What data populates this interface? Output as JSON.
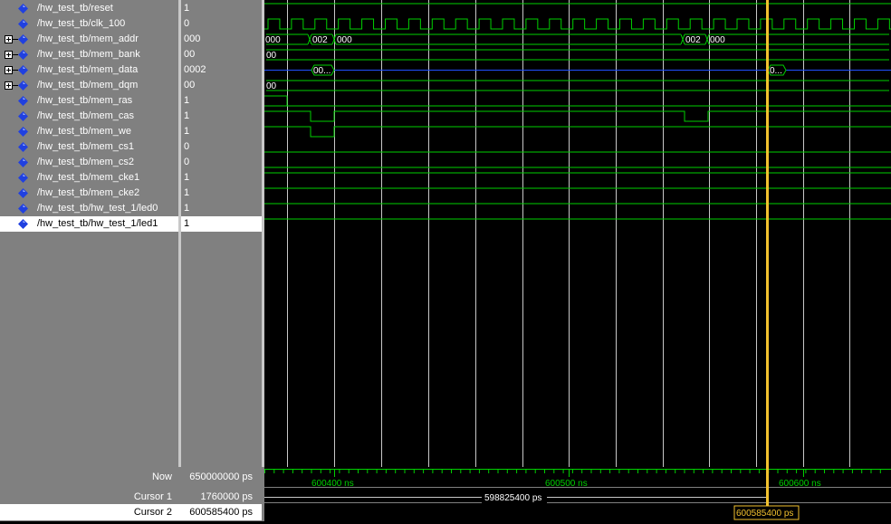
{
  "signals": [
    {
      "name": "/hw_test_tb/reset",
      "value": "1",
      "expandable": false
    },
    {
      "name": "/hw_test_tb/clk_100",
      "value": "0",
      "expandable": false
    },
    {
      "name": "/hw_test_tb/mem_addr",
      "value": "000",
      "expandable": true
    },
    {
      "name": "/hw_test_tb/mem_bank",
      "value": "00",
      "expandable": true
    },
    {
      "name": "/hw_test_tb/mem_data",
      "value": "0002",
      "expandable": true
    },
    {
      "name": "/hw_test_tb/mem_dqm",
      "value": "00",
      "expandable": true
    },
    {
      "name": "/hw_test_tb/mem_ras",
      "value": "1",
      "expandable": false
    },
    {
      "name": "/hw_test_tb/mem_cas",
      "value": "1",
      "expandable": false
    },
    {
      "name": "/hw_test_tb/mem_we",
      "value": "1",
      "expandable": false
    },
    {
      "name": "/hw_test_tb/mem_cs1",
      "value": "0",
      "expandable": false
    },
    {
      "name": "/hw_test_tb/mem_cs2",
      "value": "0",
      "expandable": false
    },
    {
      "name": "/hw_test_tb/mem_cke1",
      "value": "1",
      "expandable": false
    },
    {
      "name": "/hw_test_tb/mem_cke2",
      "value": "1",
      "expandable": false
    },
    {
      "name": "/hw_test_tb/hw_test_1/led0",
      "value": "1",
      "expandable": false
    },
    {
      "name": "/hw_test_tb/hw_test_1/led1",
      "value": "1",
      "expandable": false,
      "selected": true
    }
  ],
  "bus_labels": {
    "addr_start": "000",
    "addr_a": "002",
    "addr_b": "000",
    "addr_c": "002",
    "addr_d": "000",
    "bank": "00",
    "data_a": "00...",
    "data_b": "0...",
    "dqm": "00"
  },
  "footer": {
    "now_label": "Now",
    "now_value": "650000000 ps",
    "cursor1_label": "Cursor 1",
    "cursor1_value": "1760000 ps",
    "cursor2_label": "Cursor 2",
    "cursor2_value": "600585400 ps",
    "delta_readout": "598825400 ps",
    "cursor2_readout": "600585400 ps"
  },
  "timeline": {
    "tick_labels": [
      "600400 ns",
      "600500 ns",
      "600600 ns"
    ]
  },
  "colors": {
    "wave": "#00d000",
    "grid": "#c8c8c8",
    "cursor": "#f2c12e",
    "bus_z": "#2050ff",
    "diamond": "#2040e0"
  },
  "icons": {
    "signal": "diamond-icon",
    "expand": "plus-box-icon"
  }
}
